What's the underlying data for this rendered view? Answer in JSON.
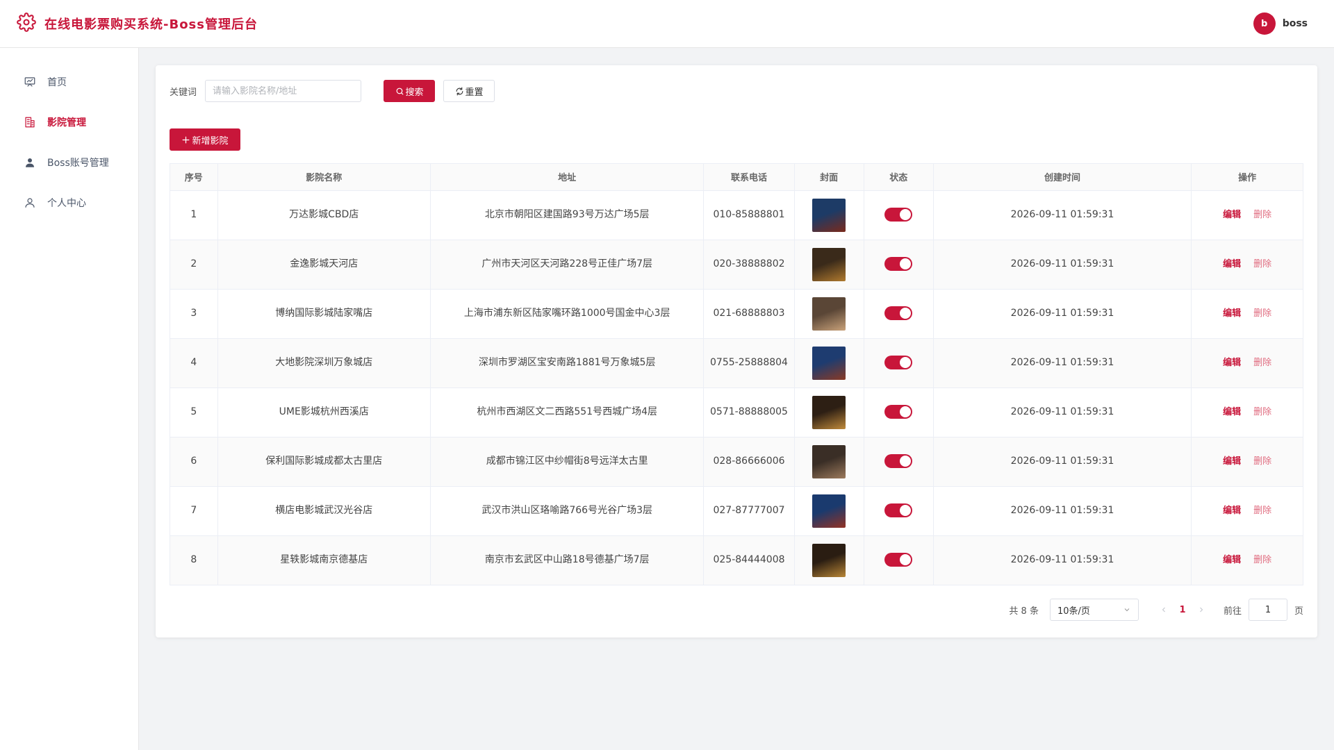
{
  "header": {
    "title": "在线电影票购买系统-Boss管理后台",
    "avatar_letter": "b",
    "user_name": "boss",
    "accent": "#c8163a"
  },
  "sidebar": {
    "items": [
      {
        "label": "首页",
        "icon": "presentation-icon",
        "active": false
      },
      {
        "label": "影院管理",
        "icon": "building-icon",
        "active": true
      },
      {
        "label": "Boss账号管理",
        "icon": "user-filled-icon",
        "active": false
      },
      {
        "label": "个人中心",
        "icon": "user-outline-icon",
        "active": false
      }
    ]
  },
  "search": {
    "label": "关键词",
    "placeholder": "请输入影院名称/地址",
    "value": "",
    "search_button": "搜索",
    "reset_button": "重置"
  },
  "toolbar": {
    "add_button": "新增影院"
  },
  "table": {
    "columns": [
      "序号",
      "影院名称",
      "地址",
      "联系电话",
      "封面",
      "状态",
      "创建时间",
      "操作"
    ],
    "edit_label": "编辑",
    "delete_label": "删除",
    "rows": [
      {
        "no": "1",
        "name": "万达影城CBD店",
        "address": "北京市朝阳区建国路93号万达广场5层",
        "phone": "010-85888801",
        "cover": [
          "#1d3b66",
          "#7a2a1c"
        ],
        "enabled": true,
        "created": "2026-09-11 01:59:31"
      },
      {
        "no": "2",
        "name": "金逸影城天河店",
        "address": "广州市天河区天河路228号正佳广场7层",
        "phone": "020-38888802",
        "cover": [
          "#3a2a1a",
          "#b07a2e"
        ],
        "enabled": true,
        "created": "2026-09-11 01:59:31"
      },
      {
        "no": "3",
        "name": "博纳国际影城陆家嘴店",
        "address": "上海市浦东新区陆家嘴环路1000号国金中心3层",
        "phone": "021-68888803",
        "cover": [
          "#5a4636",
          "#c9a27a"
        ],
        "enabled": true,
        "created": "2026-09-11 01:59:31"
      },
      {
        "no": "4",
        "name": "大地影院深圳万象城店",
        "address": "深圳市罗湖区宝安南路1881号万象城5层",
        "phone": "0755-25888804",
        "cover": [
          "#1e3c70",
          "#8a3a24"
        ],
        "enabled": true,
        "created": "2026-09-11 01:59:31"
      },
      {
        "no": "5",
        "name": "UME影城杭州西溪店",
        "address": "杭州市西湖区文二西路551号西城广场4层",
        "phone": "0571-88888005",
        "cover": [
          "#2d1f14",
          "#c08a3a"
        ],
        "enabled": true,
        "created": "2026-09-11 01:59:31"
      },
      {
        "no": "6",
        "name": "保利国际影城成都太古里店",
        "address": "成都市锦江区中纱帽街8号远洋太古里",
        "phone": "028-86666006",
        "cover": [
          "#3a2e26",
          "#9c7a5c"
        ],
        "enabled": true,
        "created": "2026-09-11 01:59:31"
      },
      {
        "no": "7",
        "name": "横店电影城武汉光谷店",
        "address": "武汉市洪山区珞喻路766号光谷广场3层",
        "phone": "027-87777007",
        "cover": [
          "#1a3a6e",
          "#943224"
        ],
        "enabled": true,
        "created": "2026-09-11 01:59:31"
      },
      {
        "no": "8",
        "name": "星轶影城南京德基店",
        "address": "南京市玄武区中山路18号德基广场7层",
        "phone": "025-84444008",
        "cover": [
          "#2a1d12",
          "#b88636"
        ],
        "enabled": true,
        "created": "2026-09-11 01:59:31"
      }
    ]
  },
  "pagination": {
    "total": "共 8 条",
    "page_size": "10条/页",
    "current_page": "1",
    "goto_label": "前往",
    "goto_value": "1",
    "goto_suffix": "页"
  }
}
